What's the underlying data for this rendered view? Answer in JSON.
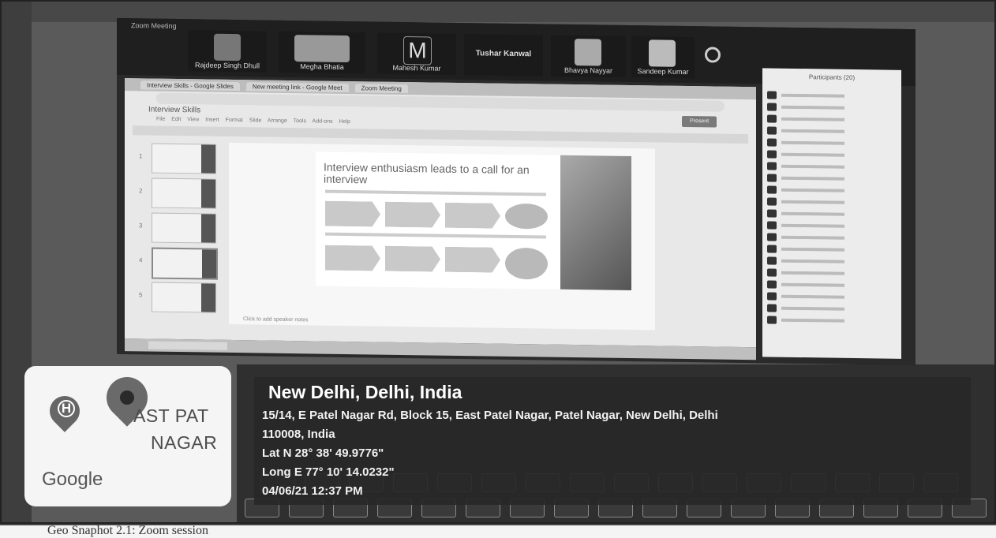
{
  "meeting": {
    "participants": [
      {
        "name": "Rajdeep Singh Dhull"
      },
      {
        "name": "Megha Bhatia"
      },
      {
        "name": "Mahesh Kumar",
        "initial": "M"
      },
      {
        "name": "Tushar Kanwal"
      },
      {
        "name": "Bhavya Nayyar"
      },
      {
        "name": "Sandeep Kumar"
      }
    ]
  },
  "browser": {
    "tabs": [
      "Interview Skills - Google Slides",
      "New meeting link - Google Meet",
      "Zoom Meeting"
    ],
    "doc_title": "Interview Skills",
    "menus": "File Edit View Insert Format Slide Arrange Tools Add-ons Help",
    "present_label": "Present"
  },
  "slide": {
    "title": "Interview enthusiasm leads to a call for an interview",
    "slide_numbers": [
      "1",
      "2",
      "3",
      "4",
      "5"
    ],
    "speaker_notes": "Click to add speaker notes"
  },
  "panel": {
    "title": "Participants (20)"
  },
  "geotag": {
    "map_labels": {
      "area_line1": "AST PAT",
      "area_line2": "NAGAR",
      "hospital_letter": "H",
      "brand": "Google"
    },
    "city": "New Delhi, Delhi, India",
    "address_line1": "15/14, E Patel Nagar Rd, Block 15, East Patel Nagar, Patel Nagar, New Delhi, Delhi",
    "address_line2": "110008, India",
    "lat": "Lat N 28° 38' 49.9776\"",
    "long": "Long E 77° 10' 14.0232\"",
    "datetime": "04/06/21 12:37 PM"
  },
  "caption": "Geo Snaphot 2.1: Zoom session"
}
